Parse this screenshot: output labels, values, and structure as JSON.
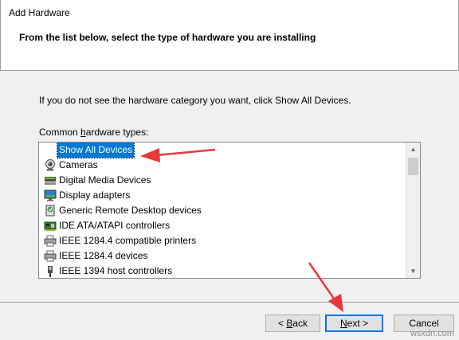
{
  "window": {
    "title": "Add Hardware"
  },
  "header": {
    "subtitle": "From the list below, select the type of hardware you are installing"
  },
  "body": {
    "instruction": "If you do not see the hardware category you want, click Show All Devices.",
    "list_label_prefix": "Common ",
    "list_label_accel": "h",
    "list_label_suffix": "ardware types:"
  },
  "list": {
    "items": [
      {
        "label": "Show All Devices",
        "icon": "none",
        "selected": true
      },
      {
        "label": "Cameras",
        "icon": "camera-icon"
      },
      {
        "label": "Digital Media Devices",
        "icon": "media-device-icon"
      },
      {
        "label": "Display adapters",
        "icon": "display-adapter-icon"
      },
      {
        "label": "Generic Remote Desktop devices",
        "icon": "remote-desktop-icon"
      },
      {
        "label": "IDE ATA/ATAPI controllers",
        "icon": "ide-controller-icon"
      },
      {
        "label": "IEEE 1284.4 compatible printers",
        "icon": "printer-icon"
      },
      {
        "label": "IEEE 1284.4 devices",
        "icon": "printer-icon"
      },
      {
        "label": "IEEE 1394 host controllers",
        "icon": "ieee1394-icon"
      }
    ]
  },
  "buttons": {
    "back_prefix": "< ",
    "back_accel": "B",
    "back_suffix": "ack",
    "next_accel": "N",
    "next_suffix": "ext >",
    "cancel": "Cancel"
  },
  "watermark": "wsxdn.com",
  "colors": {
    "selection": "#0078d7",
    "arrow": "#e8383b"
  }
}
